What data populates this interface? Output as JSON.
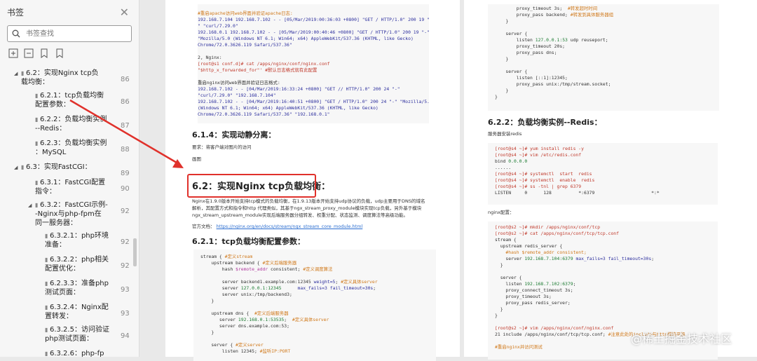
{
  "sidebar": {
    "title": "书签",
    "search_placeholder": "书签查找",
    "items": [
      {
        "label": "6.2：实现Nginx tcp负\n载均衡：",
        "page": "86"
      },
      {
        "label": "6.2.1：tcp负载均衡\n配置参数：",
        "page": "86"
      },
      {
        "label": "6.2.2：负载均衡实例\n--Redis：",
        "page": "87"
      },
      {
        "label": "6.2.3：负载均衡实例\n：MySQL",
        "page": "88"
      },
      {
        "label": "6.3：实现FastCGI：",
        "page": "89"
      },
      {
        "label": "6.3.1：FastCGI配置\n指令：",
        "page": "90"
      },
      {
        "label": "6.3.2：FastCGI示例-\n-Nginx与php-fpm在\n同一服务器：",
        "page": "92"
      },
      {
        "label": "6.3.2.1：php环境\n准备：",
        "page": "92"
      },
      {
        "label": "6.3.2.2：php相关\n配置优化：",
        "page": "92"
      },
      {
        "label": "6.2.3.3：准备php\n测试页面：",
        "page": "93"
      },
      {
        "label": "6.3.2.4：Nginx配\n置转发：",
        "page": "93"
      },
      {
        "label": "6.3.2.5：访问验证\nphp测试页面：",
        "page": "94"
      },
      {
        "label": "6.3.2.6：php-fp",
        "page": ""
      }
    ]
  },
  "left_page": {
    "log_comment": "#重启apache访问web界面并验证apache日志:",
    "log_lines": [
      "192.168.7.104 192.168.7.102 - - [05/Mar/2019:00:36:03 +0800] \"GET / HTTP/1.0\" 200 19 \"-",
      "\" \"curl/7.29.0\"",
      "192.168.0.1 192.168.7.102 - - [05/Mar/2019:00:40:46 +0800] \"GET / HTTP/1.0\" 200 19 \"-\"",
      "\"Mozilla/5.0 (Windows NT 6.1; Win64; x64) AppleWebKit/537.36 (KHTML, like Gecko)",
      "Chrome/72.0.3626.119 Safari/537.36\""
    ],
    "nginx_label": "2, Nginx:",
    "nginx_cmd": "[root@s1 conf.d]# cat /apps/nginx/conf/nginx.conf",
    "nginx_line": "\"$http_x_forwarded_for\"' #默认日志格式就有此配置",
    "restart_comment": "重启nginx访问web界面并验证日志格式:",
    "log2_lines": [
      "192.168.7.102 - - [04/Mar/2019:16:33:24 +0800] \"GET // HTTP/1.0\" 200 24 \"-\"",
      "\"curl/7.29.0\" \"192.168.7.104\"",
      "192.168.7.102 - - [04/Mar/2019:16:40:51 +0800] \"GET / HTTP/1.0\" 200 24 \"-\" \"Mozilla/5.0",
      "(Windows NT 6.1; Win64; x64) AppleWebKit/537.36 (KHTML, like Gecko)",
      "Chrome/72.0.3626.119 Safari/537.36\" \"192.168.0.1\""
    ],
    "h_614": "6.1.4：实现动静分离：",
    "req_text": "要求：将客户端对图片的访问",
    "pic_text": "画图",
    "h_62": "6.2：实现Nginx tcp负载均衡：",
    "para": [
      "Nginx在1.9.0版本开始支持tcp模式的负载均衡，在1.9.13版本开始支持udp协议的负载，udp主要用于DNS的域名",
      "解析，其配置方式和指令和http 代理类似，其基于ngx_stream_proxy_module模块实现tcp负载，另外基于模块",
      "ngx_stream_upstream_module实现后端服务器分组转发、权重分配、状态监测、调度算法等高级功能。"
    ],
    "doc_label": "官方文档：",
    "doc_link": "https://nginx.org/en/docs/stream/ngx_stream_core_module.html",
    "h_621": "6.2.1：tcp负载均衡配置参数：",
    "code": [
      "stream { #定义stream",
      "    upstream backend { #定义后端服务器",
      "        hash $remote_addr consistent; #定义调度算法",
      "",
      "        server backend1.example.com:12345 weight=5; #定义具体server",
      "        server 127.0.0.1:12345      max_fails=3 fail_timeout=30s;",
      "        server unix:/tmp/backend3;",
      "    }",
      "",
      "    upstream dns {  #定义后端服务器",
      "       server 192.168.0.1:53535;  #定义具体server",
      "       server dns.example.com:53;",
      "    }",
      "",
      "    server { #定义server",
      "        listen 12345; #监听IP:PORT"
    ]
  },
  "right_page": {
    "code_top": [
      "        proxy_timeout 3s;  #转发超时时间",
      "        proxy_pass backend; #转发到具体服务器组",
      "    }",
      "",
      "    server {",
      "        listen 127.0.0.1:53 udp reuseport;",
      "        proxy_timeout 20s;",
      "        proxy_pass dns;",
      "    }",
      "",
      "    server {",
      "        listen [::1]:12345;",
      "        proxy_pass unix:/tmp/stream.socket;",
      "    }",
      "}"
    ],
    "h_622": "6.2.2：负载均衡实例--Redis：",
    "redis_install": "服务器安装redis",
    "code_redis": [
      "[root@s4 ~]# yum install redis -y",
      "[root@s4 ~]# vim /etc/redis.conf",
      "bind 0.0.0.0",
      "......",
      "[root@s4 ~]# systemctl  start  redis",
      "[root@s4 ~]# systemctl  enable  redis",
      "[root@s4 ~]# ss -tnl | grep 6379",
      "LISTEN     0      128          *:6379                     *:*"
    ],
    "nginx_conf": "nginx配置：",
    "code_nginx": [
      "[root@s2 ~]# mkdir /apps/nginx/conf/tcp",
      "[root@s2 ~]# cat /apps/nginx/conf/tcp/tcp.conf",
      "stream {",
      "  upstream redis_server {",
      "    #hash $remote_addr consistent;",
      "    server 192.168.7.104:6379 max_fails=3 fail_timeout=30s;",
      "  }",
      "",
      "  server {",
      "    listen 192.168.7.102:6379;",
      "    proxy_connect_timeout 3s;",
      "    proxy_timeout 3s;",
      "    proxy_pass redis_server;",
      "  }",
      "}",
      "",
      "[root@s2 ~]# vim /apps/nginx/conf/nginx.conf",
      "21 include /apps/nginx/conf/tcp/tcp.conf; #注意此处的include与http模块平级",
      "",
      "#重启nginx并访问测试"
    ]
  },
  "watermark": "@稀土掘金技术社区"
}
